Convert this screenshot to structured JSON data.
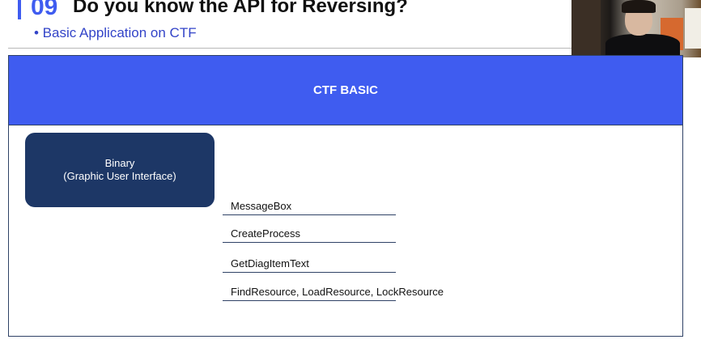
{
  "header": {
    "number": "09",
    "title": "Do you know the API for Reversing?",
    "subtitle": "• Basic Application on CTF",
    "accent_color": "#3f5cf0"
  },
  "diagram": {
    "header_label": "CTF BASIC",
    "binary_box": {
      "line1": "Binary",
      "line2": "(Graphic User Interface)"
    },
    "api_items": [
      "MessageBox",
      "CreateProcess",
      "GetDiagItemText",
      "FindResource, LoadResource, LockResource"
    ],
    "colors": {
      "header_bg": "#3f5cf0",
      "box_bg": "#1d3766",
      "border": "#2f4266"
    }
  }
}
